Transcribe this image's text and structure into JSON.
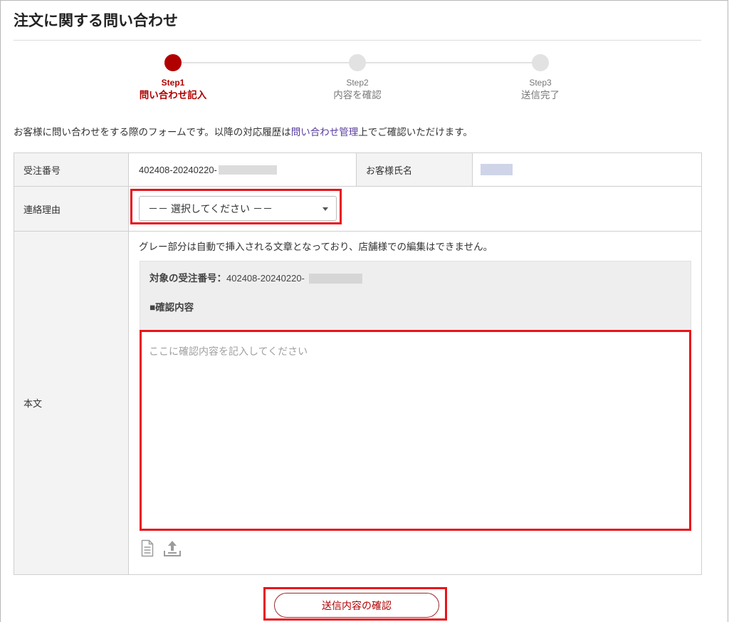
{
  "page": {
    "title": "注文に関する問い合わせ",
    "description": {
      "before_link": "お客様に問い合わせをする際のフォームです。以降の対応履歴は",
      "link": "問い合わせ管理",
      "after_link": "上でご確認いただけます。"
    }
  },
  "steps": [
    {
      "step": "Step1",
      "label": "問い合わせ記入",
      "active": true
    },
    {
      "step": "Step2",
      "label": "内容を確認",
      "active": false
    },
    {
      "step": "Step3",
      "label": "送信完了",
      "active": false
    }
  ],
  "form": {
    "order_number": {
      "label": "受注番号",
      "value": "402408-20240220-"
    },
    "customer_name": {
      "label": "お客様氏名"
    },
    "contact_reason": {
      "label": "連絡理由",
      "selected": "－－ 選択してください －－"
    },
    "body": {
      "label": "本文",
      "note": "グレー部分は自動で挿入される文章となっており、店舗様での編集はできません。",
      "fixed_text": {
        "order_label": "対象の受注番号：",
        "order_value": "402408-20240220-",
        "section_heading": "■確認内容"
      },
      "placeholder": "ここに確認内容を記入してください",
      "value": ""
    },
    "tools": {
      "attach_icon": "document-icon",
      "upload_icon": "upload-icon"
    }
  },
  "actions": {
    "confirm_label": "送信内容の確認"
  },
  "colors": {
    "accent": "#b10000",
    "highlight": "#e8141c",
    "link": "#5a3d9e",
    "inactive": "#e2e2e2"
  }
}
